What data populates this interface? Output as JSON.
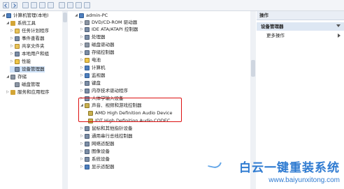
{
  "left_tree": [
    {
      "text": "计算机管理(本地)",
      "level": 0,
      "icon": "computer-icon"
    },
    {
      "text": "系统工具",
      "level": 1,
      "icon": "tools-icon"
    },
    {
      "text": "任务计划程序",
      "level": 2,
      "icon": "task-icon"
    },
    {
      "text": "事件查看器",
      "level": 2,
      "icon": "event-icon"
    },
    {
      "text": "共享文件夹",
      "level": 2,
      "icon": "folder-icon"
    },
    {
      "text": "本地用户和组",
      "level": 2,
      "icon": "users-icon"
    },
    {
      "text": "性能",
      "level": 2,
      "icon": "performance-icon"
    },
    {
      "text": "设备管理器",
      "level": 2,
      "icon": "device-icon"
    },
    {
      "text": "存储",
      "level": 1,
      "icon": "storage-icon"
    },
    {
      "text": "磁盘管理",
      "level": 2,
      "icon": "disk-icon"
    },
    {
      "text": "服务和应用程序",
      "level": 1,
      "icon": "services-icon"
    }
  ],
  "device_tree": [
    {
      "text": "admin-PC",
      "level": 0,
      "icon": "computer-icon"
    },
    {
      "text": "DVD/CD-ROM 驱动器",
      "level": 1,
      "icon": "dvd-icon"
    },
    {
      "text": "IDE ATA/ATAPI 控制器",
      "level": 1,
      "icon": "ide-icon"
    },
    {
      "text": "处理器",
      "level": 1,
      "icon": "cpu-icon"
    },
    {
      "text": "磁盘驱动器",
      "level": 1,
      "icon": "disk-icon"
    },
    {
      "text": "存储控制器",
      "level": 1,
      "icon": "storage-icon"
    },
    {
      "text": "电池",
      "level": 1,
      "icon": "battery-icon"
    },
    {
      "text": "计算机",
      "level": 1,
      "icon": "computer-icon"
    },
    {
      "text": "监视器",
      "level": 1,
      "icon": "monitor-icon"
    },
    {
      "text": "键盘",
      "level": 1,
      "icon": "keyboard-icon"
    },
    {
      "text": "内存技术驱动程序",
      "level": 1,
      "icon": "memory-icon"
    },
    {
      "text": "人体学输入设备",
      "level": 1,
      "icon": "hid-icon"
    },
    {
      "text": "声音、视频和游戏控制器",
      "level": 1,
      "icon": "sound-icon"
    },
    {
      "text": "AMD High Definition Audio Device",
      "level": 2,
      "icon": "audio-icon"
    },
    {
      "text": "IDT High Definition Audio CODEC",
      "level": 2,
      "icon": "audio-icon"
    },
    {
      "text": "鼠标和其他指针设备",
      "level": 1,
      "icon": "mouse-icon"
    },
    {
      "text": "通用串行总线控制器",
      "level": 1,
      "icon": "usb-icon"
    },
    {
      "text": "网络适配器",
      "level": 1,
      "icon": "network-icon"
    },
    {
      "text": "图像设备",
      "level": 1,
      "icon": "camera-icon"
    },
    {
      "text": "系统设备",
      "level": 1,
      "icon": "system-icon"
    },
    {
      "text": "显示适配器",
      "level": 1,
      "icon": "display-icon"
    }
  ],
  "right_panel": {
    "header": "操作",
    "action_title": "设备管理器",
    "more_actions": "更多操作"
  },
  "watermark": {
    "title": "白云一键重装系统",
    "url": "www.baiyunxitong.com"
  }
}
